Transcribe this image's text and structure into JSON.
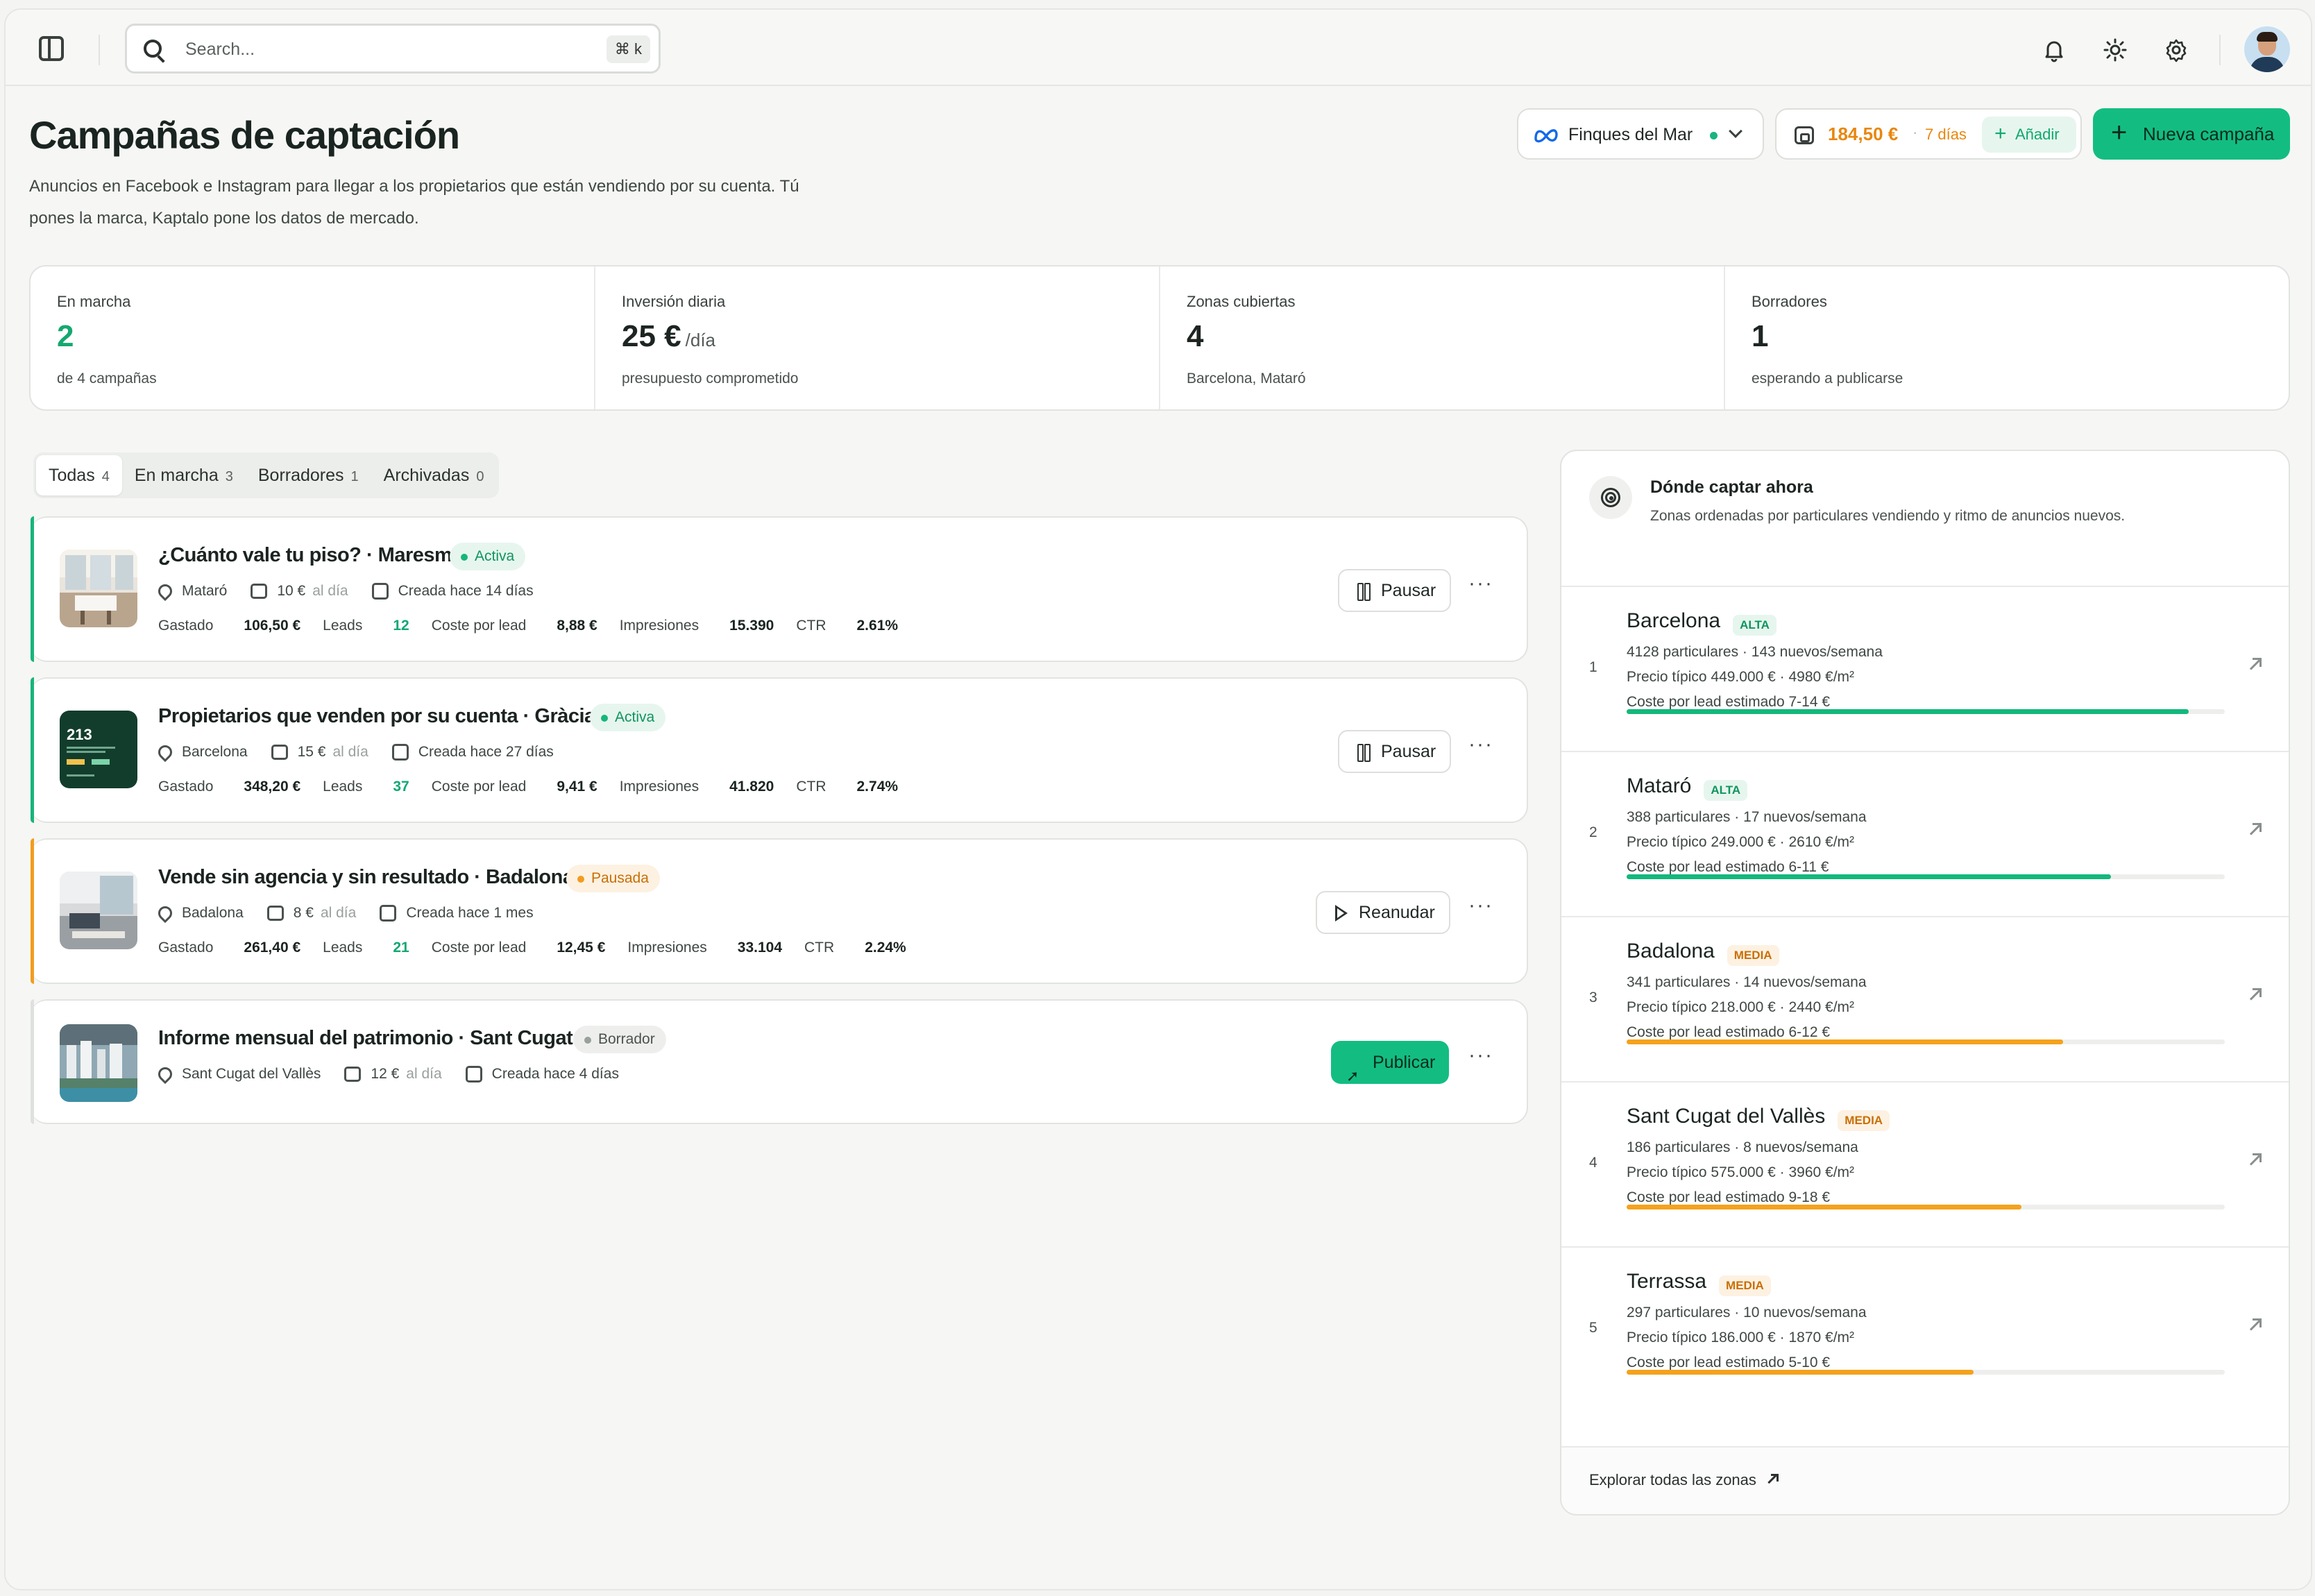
{
  "search": {
    "placeholder": "Search...",
    "shortcut": "⌘ k"
  },
  "header": {
    "title": "Campañas de captación",
    "subtitle": "Anuncios en Facebook e Instagram para llegar a los propietarios que están vendiendo por su cuenta. Tú pones la marca, Kaptalo pone los datos de mercado."
  },
  "account": {
    "name": "Finques del Mar"
  },
  "balance": {
    "value": "184,50 €",
    "days": "7 días",
    "add_label": "Añadir"
  },
  "new_campaign_label": "Nueva campaña",
  "stats": [
    {
      "label": "En marcha",
      "value": "2",
      "unit": "",
      "sub": "de 4 campañas"
    },
    {
      "label": "Inversión diaria",
      "value": "25 €",
      "unit": "/día",
      "sub": "presupuesto comprometido"
    },
    {
      "label": "Zonas cubiertas",
      "value": "4",
      "unit": "",
      "sub": "Barcelona, Mataró"
    },
    {
      "label": "Borradores",
      "value": "1",
      "unit": "",
      "sub": "esperando a publicarse"
    }
  ],
  "tabs": [
    {
      "label": "Todas",
      "count": "4"
    },
    {
      "label": "En marcha",
      "count": "3"
    },
    {
      "label": "Borradores",
      "count": "1"
    },
    {
      "label": "Archivadas",
      "count": "0"
    }
  ],
  "campaigns": [
    {
      "title": "¿Cuánto vale tu piso? · Maresme",
      "status": "Activa",
      "location": "Mataró",
      "budget": "10 €",
      "per_day": "al día",
      "created": "Creada hace 14 días",
      "spent_label": "Gastado",
      "spent": "106,50 €",
      "leads_label": "Leads",
      "leads": "12",
      "cpl_label": "Coste por lead",
      "cpl": "8,88 €",
      "imp_label": "Impresiones",
      "impressions": "15.390",
      "ctr_label": "CTR",
      "ctr": "2.61%",
      "action": "Pausar"
    },
    {
      "title": "Propietarios que venden por su cuenta · Gràcia",
      "status": "Activa",
      "location": "Barcelona",
      "budget": "15 €",
      "per_day": "al día",
      "created": "Creada hace 27 días",
      "spent_label": "Gastado",
      "spent": "348,20 €",
      "leads_label": "Leads",
      "leads": "37",
      "cpl_label": "Coste por lead",
      "cpl": "9,41 €",
      "imp_label": "Impresiones",
      "impressions": "41.820",
      "ctr_label": "CTR",
      "ctr": "2.74%",
      "action": "Pausar",
      "thumb_number": "213"
    },
    {
      "title": "Vende sin agencia y sin resultado · Badalona",
      "status": "Pausada",
      "location": "Badalona",
      "budget": "8 €",
      "per_day": "al día",
      "created": "Creada hace 1 mes",
      "spent_label": "Gastado",
      "spent": "261,40 €",
      "leads_label": "Leads",
      "leads": "21",
      "cpl_label": "Coste por lead",
      "cpl": "12,45 €",
      "imp_label": "Impresiones",
      "impressions": "33.104",
      "ctr_label": "CTR",
      "ctr": "2.24%",
      "action": "Reanudar"
    },
    {
      "title": "Informe mensual del patrimonio · Sant Cugat",
      "status": "Borrador",
      "location": "Sant Cugat del Vallès",
      "budget": "12 €",
      "per_day": "al día",
      "created": "Creada hace 4 días",
      "action": "Publicar"
    }
  ],
  "more_label": "···",
  "panel": {
    "title": "Dónde captar ahora",
    "subtitle": "Zonas ordenadas por particulares vendiendo y ritmo de anuncios nuevos.",
    "footer_link": "Explorar todas las zonas",
    "zones": [
      {
        "rank": "1",
        "name": "Barcelona",
        "tag": "ALTA",
        "line1": "4128 particulares · 143 nuevos/semana",
        "line2": "Precio típico 449.000 € · 4980 €/m²",
        "line3": "Coste por lead estimado 7-14 €",
        "score": 0.94
      },
      {
        "rank": "2",
        "name": "Mataró",
        "tag": "ALTA",
        "line1": "388 particulares · 17 nuevos/semana",
        "line2": "Precio típico 249.000 € · 2610 €/m²",
        "line3": "Coste por lead estimado 6-11 €",
        "score": 0.81
      },
      {
        "rank": "3",
        "name": "Badalona",
        "tag": "MEDIA",
        "line1": "341 particulares · 14 nuevos/semana",
        "line2": "Precio típico 218.000 € · 2440 €/m²",
        "line3": "Coste por lead estimado 6-12 €",
        "score": 0.73
      },
      {
        "rank": "4",
        "name": "Sant Cugat del Vallès",
        "tag": "MEDIA",
        "line1": "186 particulares · 8 nuevos/semana",
        "line2": "Precio típico 575.000 € · 3960 €/m²",
        "line3": "Coste por lead estimado 9-18 €",
        "score": 0.66
      },
      {
        "rank": "5",
        "name": "Terrassa",
        "tag": "MEDIA",
        "line1": "297 particulares · 10 nuevos/semana",
        "line2": "Precio típico 186.000 € · 1870 €/m²",
        "line3": "Coste por lead estimado 5-10 €",
        "score": 0.58
      }
    ]
  },
  "colors": {
    "accent": "#13bd82",
    "active": "#17b57a",
    "paused": "#f29c1f",
    "draft": "#9aa09c",
    "alta_bar": "#13b87c",
    "media_bar": "#f5a21c"
  }
}
